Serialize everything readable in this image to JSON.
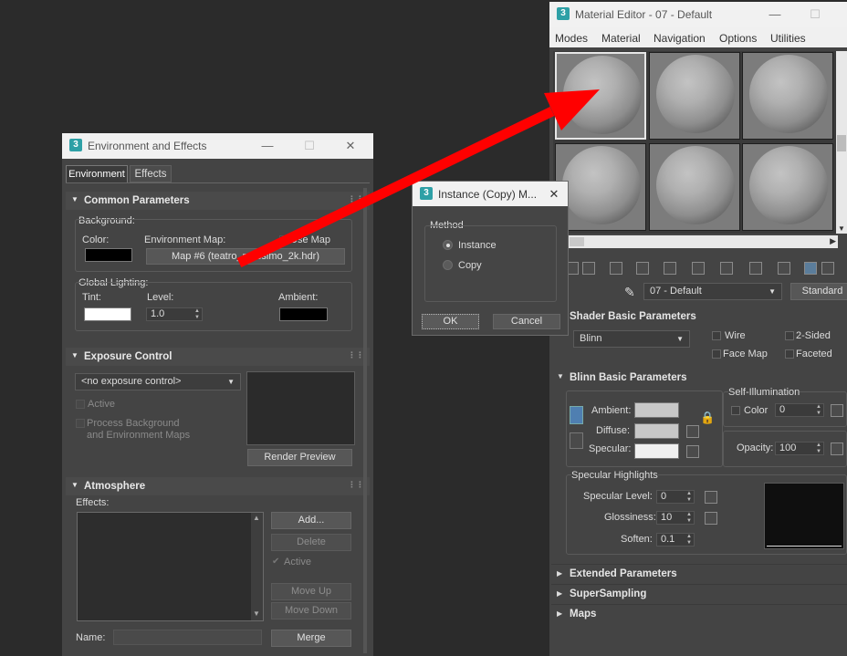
{
  "env_window": {
    "title": "Environment and Effects",
    "tabs": [
      "Environment",
      "Effects"
    ],
    "common": {
      "header": "Common Parameters",
      "background_label": "Background:",
      "color_label": "Color:",
      "env_map_label": "Environment Map:",
      "use_map_label": "Use Map",
      "map_button": "Map #6 (teatro_massimo_2k.hdr)",
      "global_lighting_label": "Global Lighting:",
      "tint_label": "Tint:",
      "level_label": "Level:",
      "level_value": "1.0",
      "ambient_label": "Ambient:"
    },
    "exposure": {
      "header": "Exposure Control",
      "dropdown": "<no exposure control>",
      "active_label": "Active",
      "process_bg_label": "Process Background",
      "process_bg_label2": "and Environment Maps",
      "render_preview": "Render Preview"
    },
    "atmosphere": {
      "header": "Atmosphere",
      "effects_label": "Effects:",
      "add": "Add...",
      "delete": "Delete",
      "active": "Active",
      "move_up": "Move Up",
      "move_down": "Move Down",
      "name_label": "Name:",
      "merge": "Merge"
    }
  },
  "dialog": {
    "title": "Instance (Copy) M...",
    "method_label": "Method",
    "option_instance": "Instance",
    "option_copy": "Copy",
    "selected": "Instance",
    "ok": "OK",
    "cancel": "Cancel"
  },
  "mat_editor": {
    "title": "Material Editor - 07 - Default",
    "menu": [
      "Modes",
      "Material",
      "Navigation",
      "Options",
      "Utilities"
    ],
    "material_name": "07 - Default",
    "type_button": "Standard",
    "shader": {
      "header": "Shader Basic Parameters",
      "shader_value": "Blinn",
      "wire": "Wire",
      "two_sided": "2-Sided",
      "face_map": "Face Map",
      "faceted": "Faceted"
    },
    "blinn": {
      "header": "Blinn Basic Parameters",
      "self_illum": "Self-Illumination",
      "color_label": "Color",
      "color_value": "0",
      "ambient": "Ambient:",
      "diffuse": "Diffuse:",
      "specular": "Specular:",
      "opacity_label": "Opacity:",
      "opacity_value": "100",
      "spec_highlights": "Specular Highlights",
      "spec_level_label": "Specular Level:",
      "spec_level_value": "0",
      "glossiness_label": "Glossiness:",
      "glossiness_value": "10",
      "soften_label": "Soften:",
      "soften_value": "0.1"
    },
    "rollouts": [
      "Extended Parameters",
      "SuperSampling",
      "Maps"
    ]
  },
  "colors": {
    "arrow": "#ff0000",
    "env_color": "#000000",
    "tint": "#ffffff",
    "ambient_env": "#000000",
    "mat_ambient": "#c8c8c8",
    "mat_diffuse": "#c8c8c8",
    "mat_specular": "#f0f0f0"
  }
}
